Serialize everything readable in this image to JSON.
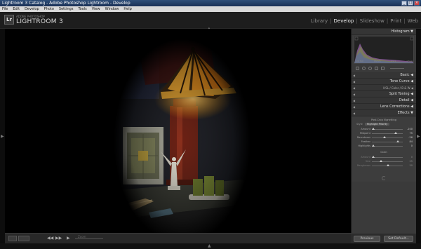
{
  "window": {
    "title": "Lightroom 3 Catalog - Adobe Photoshop Lightroom - Develop",
    "buttons": [
      "_",
      "□",
      "×"
    ]
  },
  "menu": [
    "File",
    "Edit",
    "Develop",
    "Photo",
    "Settings",
    "Tools",
    "View",
    "Window",
    "Help"
  ],
  "app": {
    "logo": "Lr",
    "subtitle": "ADOBE PHOTOSHOP",
    "name": "LIGHTROOM 3"
  },
  "modules": {
    "library": "Library",
    "develop": "Develop",
    "slideshow": "Slideshow",
    "print": "Print",
    "web": "Web",
    "active": "Develop"
  },
  "right_panel": {
    "histogram": {
      "title": "Histogram",
      "info": [
        "1/0 ISO",
        "",
        "16mm",
        "f/1.5",
        "1.5sec"
      ]
    },
    "panels": {
      "basic": "Basic",
      "tone_curve": "Tone Curve",
      "hsl_tabs": [
        "HSL",
        "/",
        "Color",
        "/",
        "B & W"
      ],
      "split_toning": "Split Toning",
      "detail": "Detail",
      "lens_corrections": "Lens Corrections",
      "effects": "Effects"
    },
    "effects": {
      "vignetting_title": "Post-Crop Vignetting",
      "style_label": "Style",
      "style_value": "Highlight Priority",
      "vignetting_sliders": [
        {
          "label": "Amount",
          "value": "-100",
          "pos": 0.0
        },
        {
          "label": "Midpoint",
          "value": "75",
          "pos": 0.75
        },
        {
          "label": "Roundness",
          "value": "-26",
          "pos": 0.37
        },
        {
          "label": "Feather",
          "value": "84",
          "pos": 0.84
        },
        {
          "label": "Highlights",
          "value": "0",
          "pos": 0.0
        }
      ],
      "grain_title": "Grain",
      "grain_sliders": [
        {
          "label": "Amount",
          "value": "0",
          "pos": 0.0
        },
        {
          "label": "Size",
          "value": "25",
          "pos": 0.25
        },
        {
          "label": "Roughness",
          "value": "50",
          "pos": 0.5
        }
      ]
    },
    "buttons": {
      "previous": "Previous",
      "set_default": "Set Default..."
    }
  },
  "toolbar": {
    "zoom_label": "Zoom"
  },
  "colors": {
    "panel_bg": "#3a3a3a",
    "lamp_glow": "#f5a623"
  }
}
